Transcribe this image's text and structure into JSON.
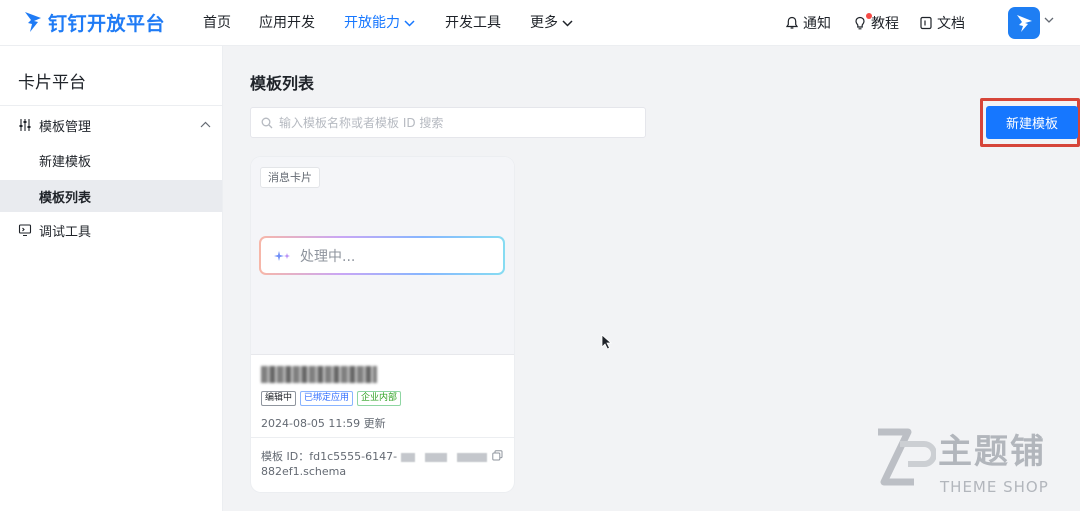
{
  "header": {
    "brand": "钉钉开放平台",
    "nav": [
      {
        "label": "首页",
        "active": false
      },
      {
        "label": "应用开发",
        "active": false
      },
      {
        "label": "开放能力",
        "active": true
      },
      {
        "label": "开发工具",
        "active": false
      },
      {
        "label": "更多",
        "active": false
      }
    ],
    "right": {
      "notify": "通知",
      "tutorial": "教程",
      "docs": "文档"
    },
    "colors": {
      "brand": "#1f7bf5",
      "active": "#1677ff",
      "dot": "#f54a45"
    }
  },
  "sidebar": {
    "title": "卡片平台",
    "items": [
      {
        "label": "模板管理",
        "icon": "sliders-icon",
        "expanded": true
      },
      {
        "label": "新建模板"
      },
      {
        "label": "模板列表",
        "selected": true
      },
      {
        "label": "调试工具",
        "icon": "monitor-icon"
      }
    ]
  },
  "main": {
    "title": "模板列表",
    "search": {
      "placeholder": "输入模板名称或者模板 ID 搜索",
      "value": ""
    },
    "new_button": "新建模板",
    "cards": [
      {
        "type_tag": "消息卡片",
        "preview_text": "处理中...",
        "badges": [
          "编辑中",
          "已绑定应用",
          "企业内部"
        ],
        "updated": "2024-08-05 11:59 更新",
        "template_id_prefix": "模板 ID：fd1c5555-6147-",
        "template_id_suffix": "882ef1.schema"
      }
    ]
  },
  "watermark": {
    "text": "主题铺",
    "sub": "THEME SHOP"
  }
}
